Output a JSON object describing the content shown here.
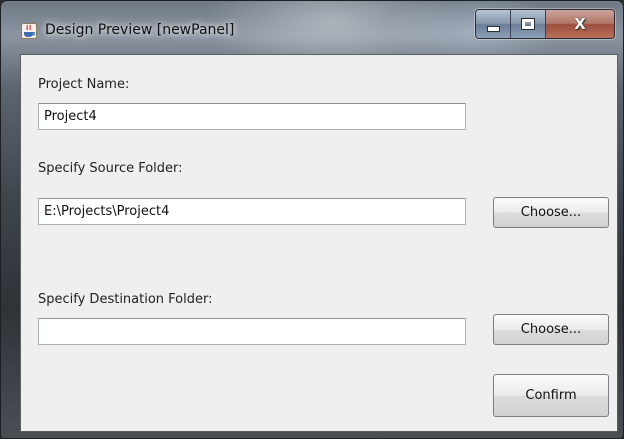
{
  "window": {
    "title": "Design Preview [newPanel]",
    "caption_buttons": {
      "minimize": "_",
      "maximize": "□",
      "close": "X"
    }
  },
  "form": {
    "project_name": {
      "label": "Project Name:",
      "value": "Project4"
    },
    "source_folder": {
      "label": "Specify Source Folder:",
      "value": "E:\\Projects\\Project4",
      "button": "Choose..."
    },
    "destination_folder": {
      "label": "Specify Destination Folder:",
      "value": "",
      "button": "Choose..."
    },
    "confirm_button": "Confirm"
  },
  "icons": {
    "app": "java-coffee-cup-icon"
  },
  "colors": {
    "client_background": "#efefef",
    "close_button": "#b27667"
  }
}
